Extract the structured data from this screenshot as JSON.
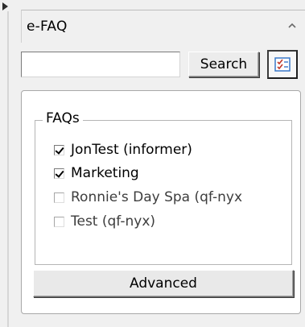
{
  "panel": {
    "title": "e-FAQ",
    "collapse_icon": "chevron-up-icon"
  },
  "search": {
    "value": "",
    "placeholder": "",
    "button_label": "Search",
    "toggle_icon": "checklist-icon"
  },
  "faqs": {
    "legend": "FAQs",
    "items": [
      {
        "label": "JonTest (informer)",
        "checked": true
      },
      {
        "label": "Marketing",
        "checked": true
      },
      {
        "label": "Ronnie's Day Spa (qf-nyx",
        "checked": false
      },
      {
        "label": "Test (qf-nyx)",
        "checked": false
      }
    ]
  },
  "advanced_button_label": "Advanced",
  "colors": {
    "background": "#f0f0f0",
    "panel_white": "#ffffff",
    "icon_red": "#c0392b",
    "icon_blue": "#3a78c9"
  }
}
